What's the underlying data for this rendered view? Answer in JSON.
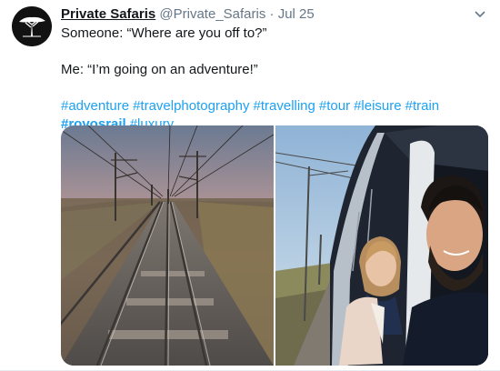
{
  "tweet": {
    "author_name": "Private Safaris",
    "handle": "@Private_Safaris",
    "separator": "·",
    "date": "Jul 25",
    "lines": [
      "Someone: “Where are you off to?”",
      "Me: “I’m going on an adventure!”"
    ],
    "hashtags_line1": [
      "#adventure",
      "#travelphotography",
      "#travelling",
      "#tour",
      "#leisure",
      "#train"
    ],
    "hashtags_line2": [
      "#rovosrail",
      "#luxury"
    ],
    "link_color": "#1da1f2",
    "icons": {
      "avatar": "acacia-tree-logo-icon",
      "menu": "chevron-down-icon"
    }
  },
  "media": {
    "photos": [
      "railway-tracks-sunset-photo",
      "train-window-selfie-photo"
    ]
  }
}
